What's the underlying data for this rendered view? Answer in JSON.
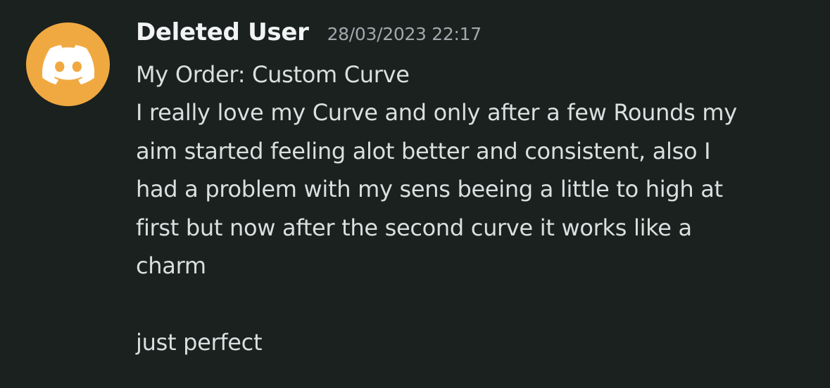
{
  "author": {
    "name": "Deleted User",
    "avatar_icon": "discord-logo-icon",
    "avatar_color": "#f0a941"
  },
  "message": {
    "timestamp": "28/03/2023 22:17",
    "lines": [
      "My Order: Custom Curve",
      "I really love my Curve and only after a few Rounds my",
      "aim started feeling alot better and consistent, also I",
      "had a problem with my sens beeing a little to high at",
      "first but now after the second curve it works like a",
      "charm",
      "",
      "just perfect"
    ]
  },
  "colors": {
    "background": "#1a211f",
    "username": "#f2f3f5",
    "timestamp": "#a4a8ad",
    "text": "#dcdedf"
  }
}
